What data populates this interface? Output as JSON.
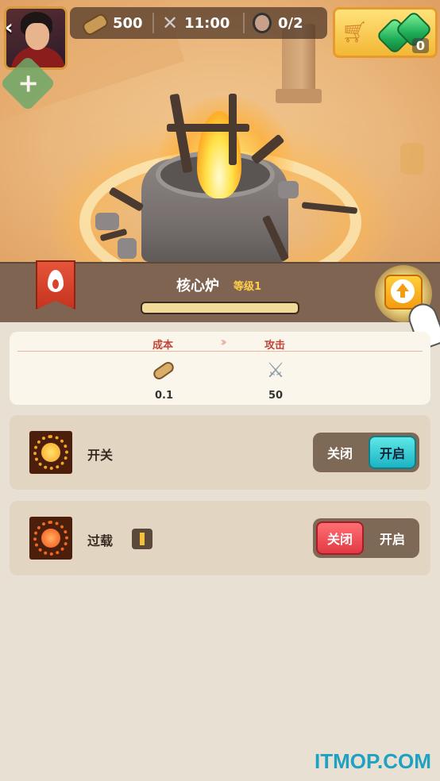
{
  "hud": {
    "wood": "500",
    "time": "11:00",
    "workers": "0/2",
    "shop_count": "0"
  },
  "building": {
    "name": "核心炉",
    "level": "等级1",
    "progress": 0
  },
  "stats": {
    "cost_label": "成本",
    "attack_label": "攻击",
    "cost_value": "0.1",
    "attack_value": "50",
    "chevrons": "›››"
  },
  "rows": [
    {
      "label": "开关",
      "off": "关闭",
      "on": "开启",
      "selected": "on"
    },
    {
      "label": "过载",
      "off": "关闭",
      "on": "开启",
      "selected": "off"
    }
  ],
  "watermark": "ITMOP.COM",
  "colors": {
    "accent_orange": "#f08b1c",
    "toggle_on": "#1bb4c4",
    "toggle_off": "#e23a44"
  }
}
